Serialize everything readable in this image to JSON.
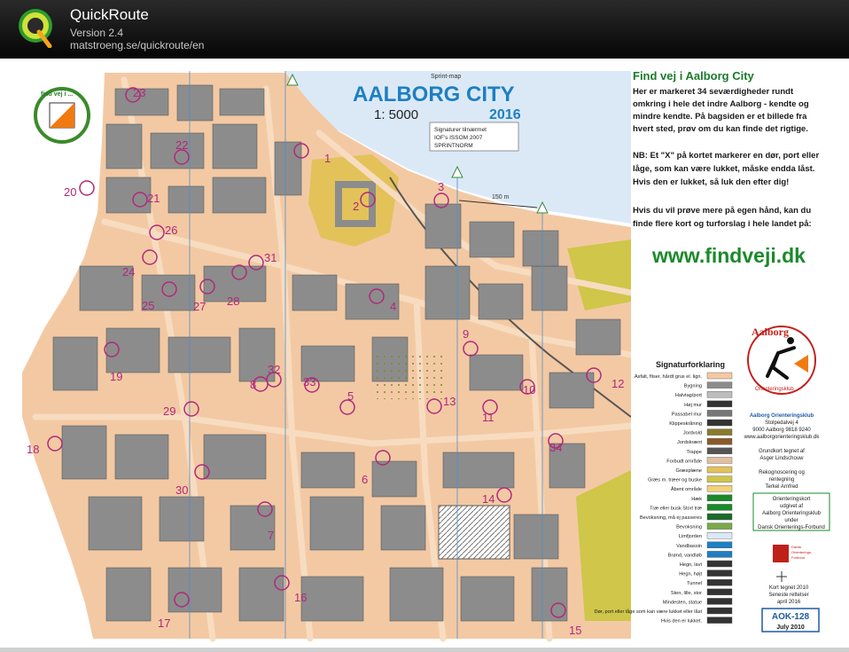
{
  "app": {
    "title": "QuickRoute",
    "version": "Version 2.4",
    "url": "matstroeng.se/quickroute/en"
  },
  "map": {
    "title": "AALBORG CITY",
    "type_label": "Sprint-map",
    "scale": "1: 5000",
    "year": "2016",
    "norm_lines": [
      "Signaturer tilnærmet",
      "IOF's ISSOM 2007",
      "SPRINTNORM"
    ],
    "scalebar_label": "150 m",
    "badge_text": "find vej i ...",
    "colors": {
      "paved": "#f3c9a4",
      "building": "#8c8c8c",
      "green": "#cfc64a",
      "water": "#dbe9f7",
      "control": "#b0297a",
      "title": "#1e7fc2",
      "url": "#1a8a2a"
    },
    "controls": [
      {
        "n": "1"
      },
      {
        "n": "2"
      },
      {
        "n": "3"
      },
      {
        "n": "4"
      },
      {
        "n": "5"
      },
      {
        "n": "6"
      },
      {
        "n": "7"
      },
      {
        "n": "8"
      },
      {
        "n": "9"
      },
      {
        "n": "10"
      },
      {
        "n": "11"
      },
      {
        "n": "12"
      },
      {
        "n": "13"
      },
      {
        "n": "14"
      },
      {
        "n": "15"
      },
      {
        "n": "16"
      },
      {
        "n": "17"
      },
      {
        "n": "18"
      },
      {
        "n": "19"
      },
      {
        "n": "20"
      },
      {
        "n": "21"
      },
      {
        "n": "22"
      },
      {
        "n": "23"
      },
      {
        "n": "24"
      },
      {
        "n": "25"
      },
      {
        "n": "26"
      },
      {
        "n": "27"
      },
      {
        "n": "28"
      },
      {
        "n": "29"
      },
      {
        "n": "30"
      },
      {
        "n": "31"
      },
      {
        "n": "32"
      },
      {
        "n": "33"
      },
      {
        "n": "34"
      }
    ]
  },
  "info": {
    "heading": "Find vej i Aalborg City",
    "para1": [
      "Her er markeret 34 seværdigheder rundt",
      "omkring i hele det indre Aalborg - kendte og",
      "mindre kendte.  På bagsiden er et billede fra",
      "hvert sted, prøv om du kan finde det rigtige."
    ],
    "para2": [
      "NB: Et \"X\" på kortet markerer en dør, port eller",
      "låge, som kan være lukket, måske endda låst.",
      "Hvis den er lukket, så luk den efter dig!"
    ],
    "para3": [
      "Hvis du vil prøve mere på egen hånd, kan du",
      "finde flere kort og turforslag i hele landet på:"
    ],
    "website": "www.findveji.dk"
  },
  "club": {
    "logo_top": "Aalborg",
    "logo_bottom": "Orienteringsklub",
    "name": "Aalborg Orienteringsklub",
    "address": [
      "Stolpedalvej 4",
      "9000 Aalborg   9818 9240",
      "www.aalborgorienteringsklub.dk"
    ],
    "credits": [
      "Grundkort tegnet af",
      "Asger Lindschouw",
      "",
      "Rekognoscering og",
      "rentegning",
      "Terkel Arnfred"
    ],
    "publisher": [
      "Orienteringskort",
      "udgivet af",
      "Aalborg Orienteringsklub",
      "under",
      "Dansk Orienterings-Forbund"
    ],
    "dof_logo": [
      "Dansk",
      "Orienterings-",
      "Forbund"
    ],
    "revision": [
      "Kort tegnet 2010",
      "Seneste rettelser",
      "april 2016"
    ],
    "map_id": "AOK-128",
    "map_date": "July 2010"
  },
  "legend": {
    "title": "Signaturforklaring",
    "items": [
      "Asfalt, fliser, hårdt grus el. lign.",
      "Bygning",
      "Halvtag/port",
      "Høj mur",
      "Passabel mur",
      "Klippeskråning",
      "Jordvold",
      "Jordskrænt",
      "Trappe",
      "Forbudt område",
      "Græsplæne",
      "Græs m. træer og buske",
      "Åbent område",
      "Hæk",
      "Træ eller busk  Stort træ",
      "Bevoksning, må ej passeres",
      "Bevoksning",
      "Limfjorden",
      "Vandbassin",
      "Brønd, vandløb",
      "Hegn, lavt",
      "Hegn, højt",
      "Tunnel",
      "Sten, lille, stor",
      "Mindesten, statue",
      "Dør, port eller låge som kan være lukket eller låst",
      "Hvis den er lukket."
    ]
  }
}
